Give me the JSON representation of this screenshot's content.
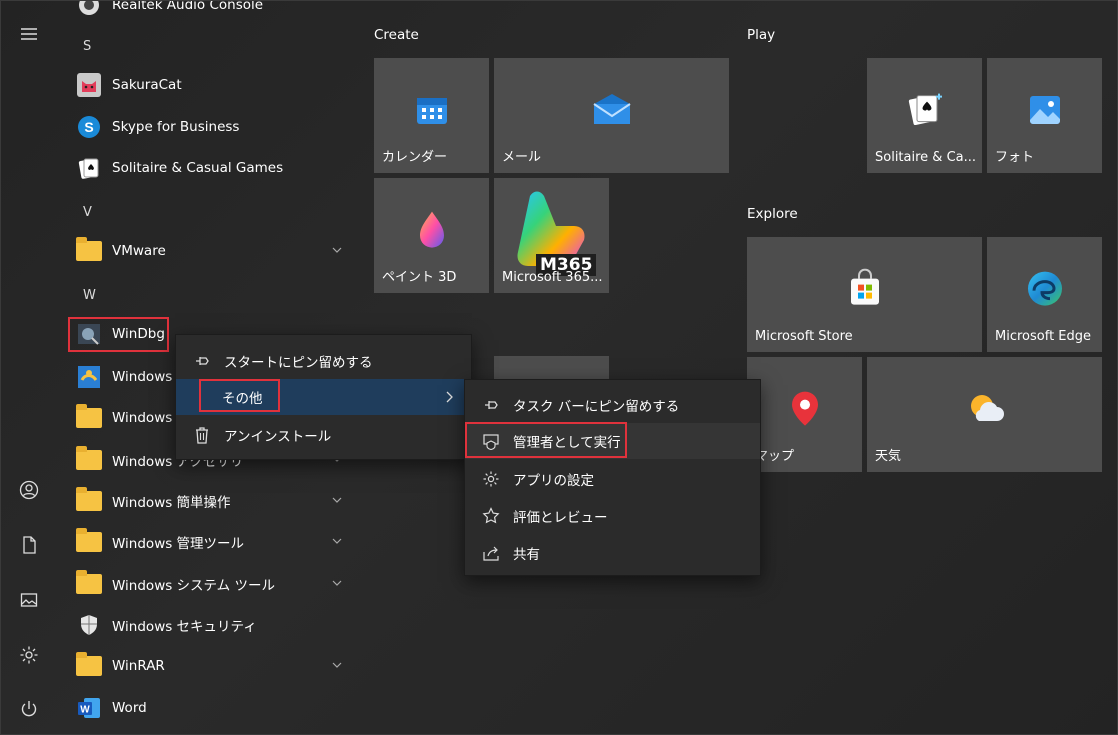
{
  "rail": {
    "icons": [
      "hamburger-menu-icon",
      "user-icon",
      "documents-icon",
      "pictures-icon",
      "settings-icon",
      "power-icon"
    ]
  },
  "applist": {
    "partial_top": "Realtek Audio Console",
    "letters": [
      "S",
      "V",
      "W"
    ],
    "items": [
      {
        "label": "SakuraCat"
      },
      {
        "label": "Skype for Business"
      },
      {
        "label": "Solitaire & Casual Games"
      },
      {
        "label": "VMware"
      },
      {
        "label": "WinDbg"
      },
      {
        "label": "Windows F"
      },
      {
        "label": "Windows F"
      },
      {
        "label": "Windows アクセサリ"
      },
      {
        "label": "Windows 簡単操作"
      },
      {
        "label": "Windows 管理ツール"
      },
      {
        "label": "Windows システム ツール"
      },
      {
        "label": "Windows セキュリティ"
      },
      {
        "label": "WinRAR"
      },
      {
        "label": "Word"
      }
    ]
  },
  "groups": {
    "create": "Create",
    "play": "Play",
    "explore": "Explore"
  },
  "tiles": {
    "calendar": "カレンダー",
    "mail": "メール",
    "paint3d": "ペイント 3D",
    "m365": "Microsoft 365...",
    "m365_badge": "M365",
    "solitaire": "Solitaire & Ca...",
    "photos": "フォト",
    "store": "Microsoft Store",
    "edge": "Microsoft Edge",
    "maps": "マップ",
    "weather": "天気"
  },
  "context_menu": {
    "pin_start": "スタートにピン留めする",
    "more": "その他",
    "uninstall": "アンインストール"
  },
  "submenu": {
    "pin_taskbar": "タスク バーにピン留めする",
    "run_admin": "管理者として実行",
    "app_settings": "アプリの設定",
    "rate_review": "評価とレビュー",
    "share": "共有"
  },
  "colors": {
    "highlight_border": "#e0323c",
    "menu_hover": "#1f3d5c",
    "tile_bg": "#4d4d4d"
  }
}
